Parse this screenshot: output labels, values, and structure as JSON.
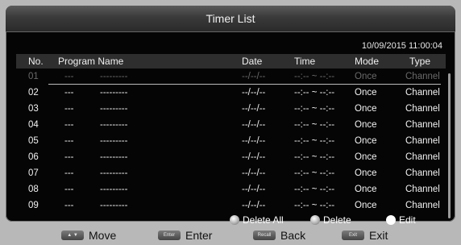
{
  "title": "Timer List",
  "datetime": "10/09/2015 11:00:04",
  "columns": {
    "no": "No.",
    "program": "Program Name",
    "date": "Date",
    "time": "Time",
    "mode": "Mode",
    "type": "Type"
  },
  "rows": [
    {
      "no": "01",
      "prog": "---",
      "name": "---------",
      "date": "--/--/--",
      "time": "--:-- ~ --:--",
      "mode": "Once",
      "type": "Channel"
    },
    {
      "no": "02",
      "prog": "---",
      "name": "---------",
      "date": "--/--/--",
      "time": "--:-- ~ --:--",
      "mode": "Once",
      "type": "Channel"
    },
    {
      "no": "03",
      "prog": "---",
      "name": "---------",
      "date": "--/--/--",
      "time": "--:-- ~ --:--",
      "mode": "Once",
      "type": "Channel"
    },
    {
      "no": "04",
      "prog": "---",
      "name": "---------",
      "date": "--/--/--",
      "time": "--:-- ~ --:--",
      "mode": "Once",
      "type": "Channel"
    },
    {
      "no": "05",
      "prog": "---",
      "name": "---------",
      "date": "--/--/--",
      "time": "--:-- ~ --:--",
      "mode": "Once",
      "type": "Channel"
    },
    {
      "no": "06",
      "prog": "---",
      "name": "---------",
      "date": "--/--/--",
      "time": "--:-- ~ --:--",
      "mode": "Once",
      "type": "Channel"
    },
    {
      "no": "07",
      "prog": "---",
      "name": "---------",
      "date": "--/--/--",
      "time": "--:-- ~ --:--",
      "mode": "Once",
      "type": "Channel"
    },
    {
      "no": "08",
      "prog": "---",
      "name": "---------",
      "date": "--/--/--",
      "time": "--:-- ~ --:--",
      "mode": "Once",
      "type": "Channel"
    },
    {
      "no": "09",
      "prog": "---",
      "name": "---------",
      "date": "--/--/--",
      "time": "--:-- ~ --:--",
      "mode": "Once",
      "type": "Channel"
    }
  ],
  "actions": {
    "delete_all": "Delete All",
    "delete": "Delete",
    "edit": "Edit"
  },
  "footer": [
    {
      "key": "▲ ▼",
      "label": "Move",
      "icon": "up-down-keys-icon"
    },
    {
      "key": "Enter",
      "label": "Enter",
      "icon": "enter-key-icon"
    },
    {
      "key": "Recall",
      "label": "Back",
      "icon": "recall-key-icon"
    },
    {
      "key": "Exit",
      "label": "Exit",
      "icon": "exit-key-icon"
    }
  ],
  "colors": {
    "panel": "#050505",
    "title_bar": "#3a3a3a",
    "header_bar": "#2e2e2e",
    "background": "#b8b8b8"
  }
}
